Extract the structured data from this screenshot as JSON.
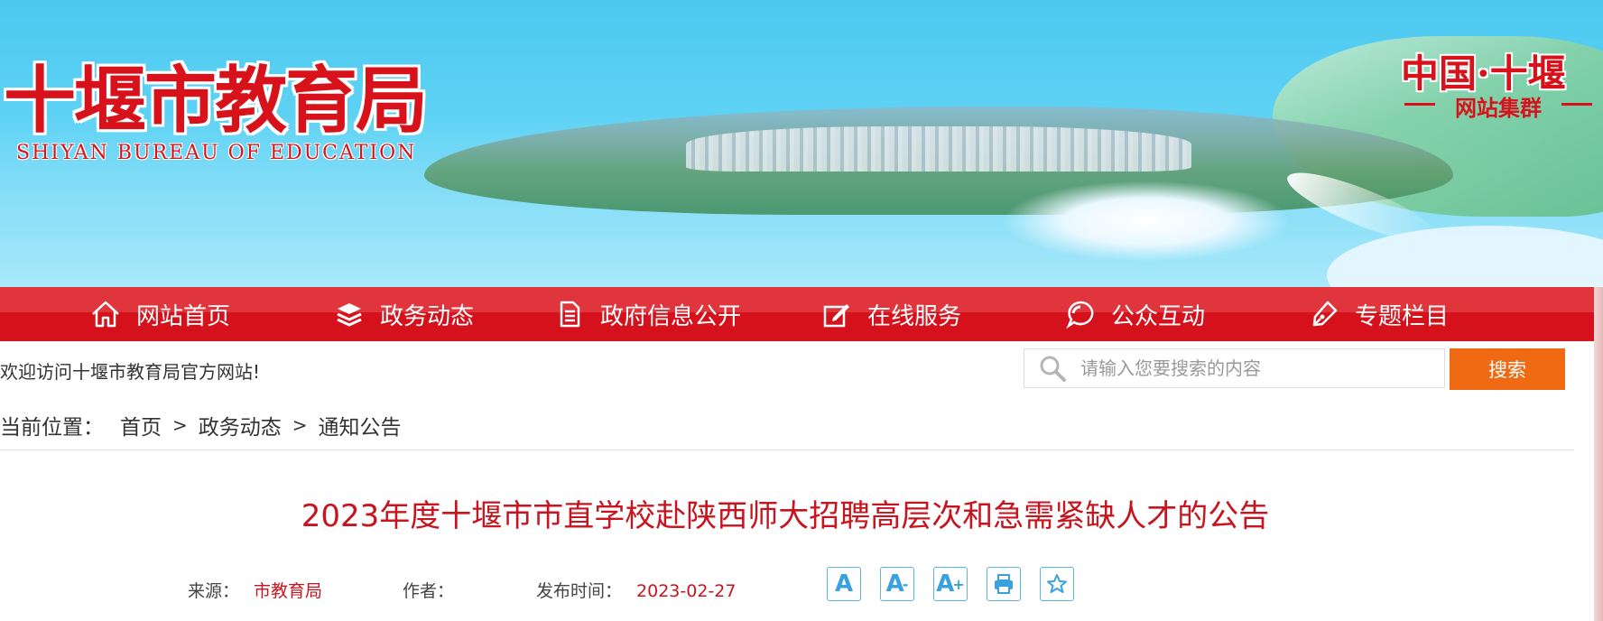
{
  "header": {
    "logo_cn": "十堰市教育局",
    "logo_en": "SHIYAN BUREAU OF EDUCATION",
    "group_title": "中国·十堰",
    "group_sub": "网站集群"
  },
  "nav": {
    "items": [
      {
        "label": "网站首页",
        "icon": "home-icon"
      },
      {
        "label": "政务动态",
        "icon": "layers-icon"
      },
      {
        "label": "政府信息公开",
        "icon": "document-icon"
      },
      {
        "label": "在线服务",
        "icon": "edit-icon"
      },
      {
        "label": "公众互动",
        "icon": "chat-icon"
      },
      {
        "label": "专题栏目",
        "icon": "pen-icon"
      }
    ]
  },
  "welcome": "欢迎访问十堰市教育局官方网站!",
  "search": {
    "placeholder": "请输入您要搜索的内容",
    "button": "搜索"
  },
  "breadcrumb": {
    "label": "当前位置：",
    "items": [
      "首页",
      "政务动态",
      "通知公告"
    ],
    "separator": ">"
  },
  "article": {
    "title": "2023年度十堰市市直学校赴陕西师大招聘高层次和急需紧缺人才的公告",
    "source_label": "来源：",
    "source": "市教育局",
    "author_label": "作者：",
    "author": "",
    "date_label": "发布时间：",
    "date": "2023-02-27"
  },
  "tools": {
    "font_normal": "A",
    "font_smaller": "A",
    "font_larger": "A",
    "minus": "-",
    "plus": "+"
  },
  "colors": {
    "brand_red": "#d5111b",
    "title_red": "#c8141e",
    "search_orange": "#ef6a12",
    "tool_blue": "#3aa1df"
  }
}
